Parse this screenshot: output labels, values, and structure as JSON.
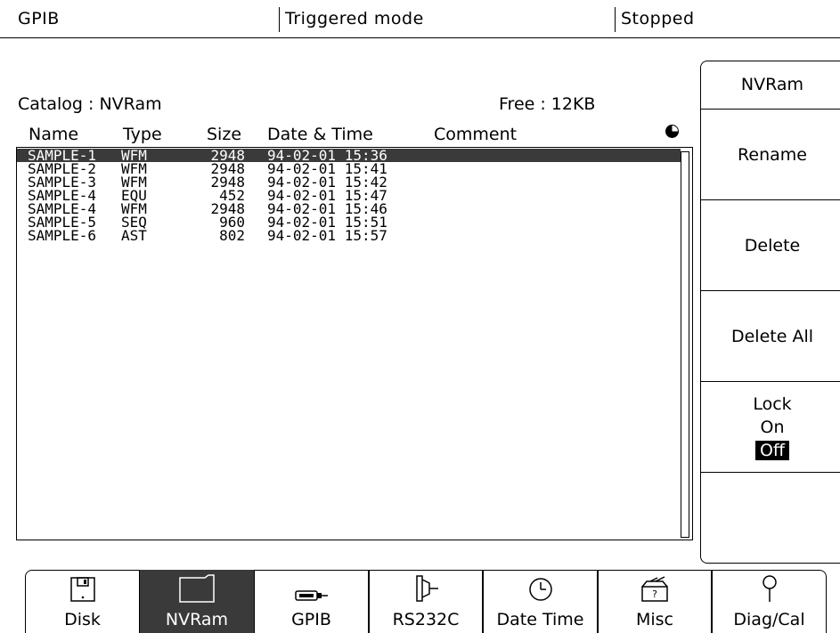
{
  "status_bar": {
    "interface": "GPIB",
    "mode": "Triggered mode",
    "state": "Stopped"
  },
  "catalog": {
    "title": "Catalog : NVRam",
    "free": "Free : 12KB",
    "columns": {
      "name": "Name",
      "type": "Type",
      "size": "Size",
      "date_time": "Date & Time",
      "comment": "Comment"
    },
    "files": [
      {
        "name": "SAMPLE-1",
        "type": "WFM",
        "size": "2948",
        "date": "94-02-01 15:36",
        "comment": ""
      },
      {
        "name": "SAMPLE-2",
        "type": "WFM",
        "size": "2948",
        "date": "94-02-01 15:41",
        "comment": ""
      },
      {
        "name": "SAMPLE-3",
        "type": "WFM",
        "size": "2948",
        "date": "94-02-01 15:42",
        "comment": ""
      },
      {
        "name": "SAMPLE-4",
        "type": "EQU",
        "size": "452",
        "date": "94-02-01 15:47",
        "comment": ""
      },
      {
        "name": "SAMPLE-4",
        "type": "WFM",
        "size": "2948",
        "date": "94-02-01 15:46",
        "comment": ""
      },
      {
        "name": "SAMPLE-5",
        "type": "SEQ",
        "size": "960",
        "date": "94-02-01 15:51",
        "comment": ""
      },
      {
        "name": "SAMPLE-6",
        "type": "AST",
        "size": "802",
        "date": "94-02-01 15:57",
        "comment": ""
      }
    ],
    "selected_index": 0
  },
  "side_menu": {
    "title": "NVRam",
    "rename": "Rename",
    "delete": "Delete",
    "delete_all": "Delete All",
    "lock": {
      "label": "Lock",
      "on": "On",
      "off": "Off",
      "selected": "Off"
    }
  },
  "bottom_tabs": [
    {
      "label": "Disk",
      "icon": "floppy-disk-icon"
    },
    {
      "label": "NVRam",
      "icon": "folder-icon",
      "active": true
    },
    {
      "label": "GPIB",
      "icon": "gpib-connector-icon"
    },
    {
      "label": "RS232C",
      "icon": "serial-connector-icon"
    },
    {
      "label": "Date Time",
      "icon": "clock-icon"
    },
    {
      "label": "Misc",
      "icon": "toolbox-icon"
    },
    {
      "label": "Diag/Cal",
      "icon": "probe-icon"
    }
  ]
}
